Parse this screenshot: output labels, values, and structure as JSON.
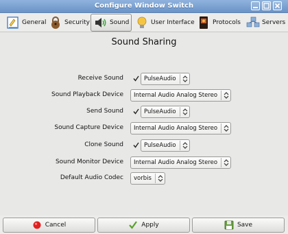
{
  "window": {
    "title": "Configure Window Switch"
  },
  "tabs": [
    {
      "label": "General",
      "icon": "general-icon"
    },
    {
      "label": "Security",
      "icon": "security-icon"
    },
    {
      "label": "Sound",
      "icon": "sound-icon",
      "active": true
    },
    {
      "label": "User Interface",
      "icon": "user-interface-icon"
    },
    {
      "label": "Protocols",
      "icon": "protocols-icon"
    },
    {
      "label": "Servers",
      "icon": "servers-icon"
    }
  ],
  "section": {
    "title": "Sound Sharing"
  },
  "settings": {
    "receive_sound": {
      "label": "Receive Sound",
      "checked": true,
      "value": "PulseAudio"
    },
    "playback_device": {
      "label": "Sound Playback Device",
      "value": "Internal Audio Analog Stereo"
    },
    "send_sound": {
      "label": "Send Sound",
      "checked": true,
      "value": "PulseAudio"
    },
    "capture_device": {
      "label": "Sound Capture Device",
      "value": "Internal Audio Analog Stereo"
    },
    "clone_sound": {
      "label": "Clone Sound",
      "checked": true,
      "value": "PulseAudio"
    },
    "monitor_device": {
      "label": "Sound Monitor Device",
      "value": "Internal Audio Analog Stereo"
    },
    "audio_codec": {
      "label": "Default Audio Codec",
      "value": "vorbis"
    }
  },
  "buttons": {
    "cancel": "Cancel",
    "apply": "Apply",
    "save": "Save"
  },
  "colors": {
    "titlebar": "#7aa0d2",
    "cancel_icon": "#e02020",
    "apply_icon": "#5aa02c",
    "save_icon": "#4a7a2a"
  }
}
